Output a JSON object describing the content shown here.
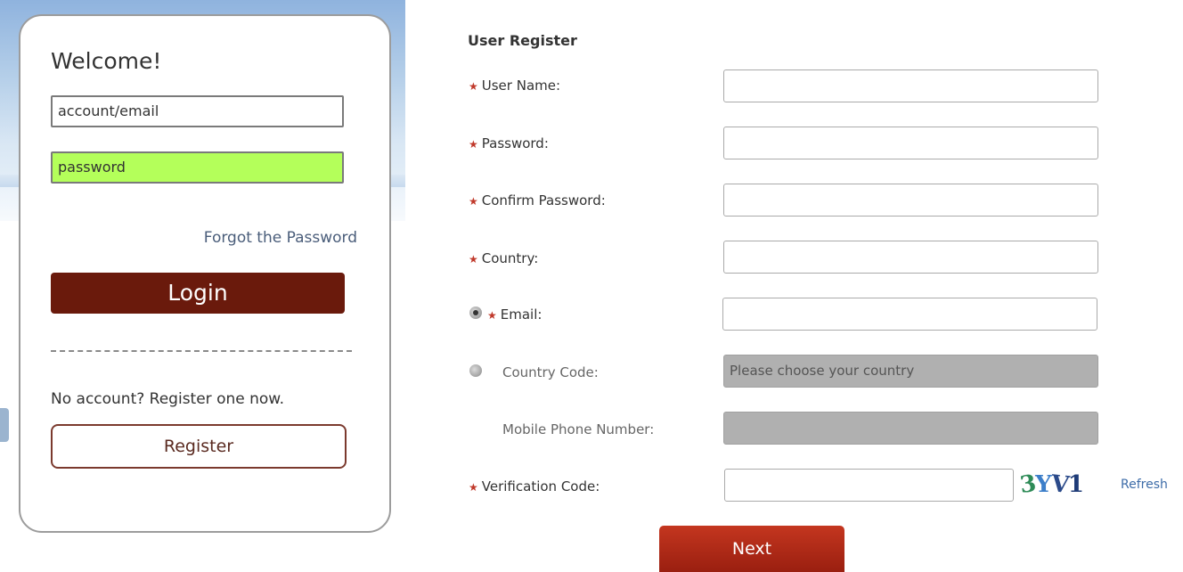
{
  "login": {
    "welcome": "Welcome!",
    "account_placeholder": "account/email",
    "password_placeholder": "password",
    "forgot": "Forgot the Password",
    "login_label": "Login",
    "no_account": "No account? Register one now.",
    "register_label": "Register"
  },
  "register": {
    "title": "User Register",
    "fields": {
      "user_name": "User Name:",
      "password": "Password:",
      "confirm_password": "Confirm Password:",
      "country": "Country:",
      "email": "Email:",
      "country_code": "Country Code:",
      "mobile": "Mobile Phone Number:",
      "verification": "Verification Code:"
    },
    "country_code_placeholder": "Please choose your country",
    "captcha": [
      "3",
      "Y",
      "V",
      "1"
    ],
    "refresh": "Refresh",
    "next_label": "Next",
    "contact_method": "email"
  },
  "colors": {
    "accent": "#6a1a0c",
    "password_fill": "#b4ff5a",
    "required_star": "#c0392b",
    "link": "#3d6ca8"
  }
}
